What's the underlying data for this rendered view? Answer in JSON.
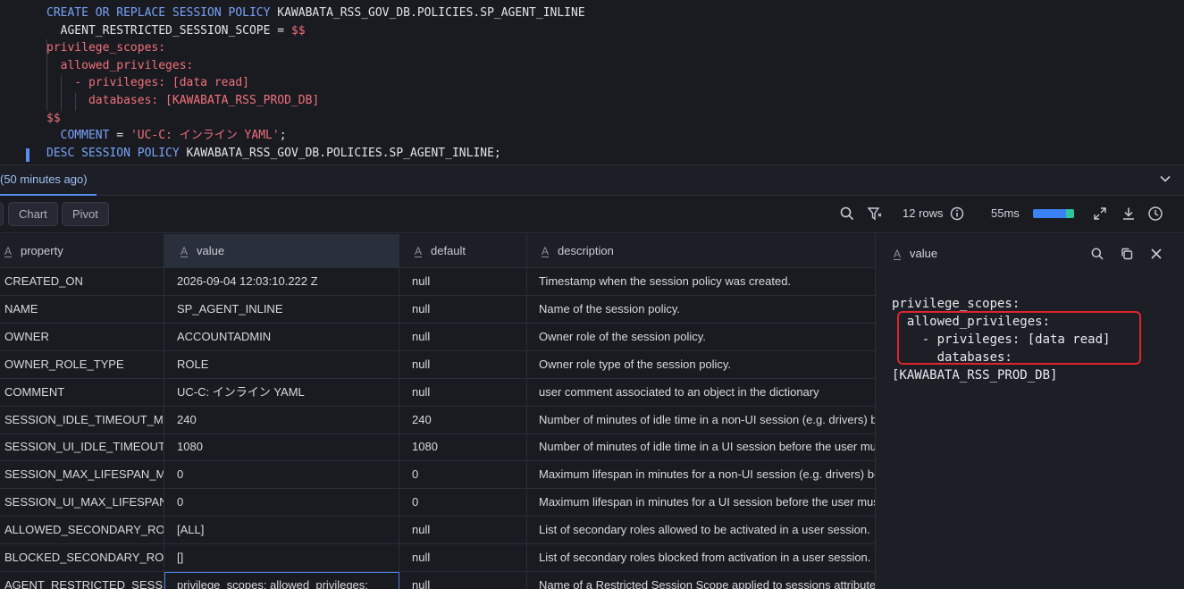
{
  "editor": {
    "ghost_line": "                        ",
    "lines": [
      {
        "parts": [
          {
            "t": "CREATE OR REPLACE SESSION POLICY ",
            "c": "kw"
          },
          {
            "t": "KAWABATA_RSS_GOV_DB.POLICIES.SP_AGENT_INLINE",
            "c": "id"
          }
        ]
      },
      {
        "parts": [
          {
            "t": "  AGENT_RESTRICTED_SESSION_SCOPE = ",
            "c": "id"
          },
          {
            "t": "$$",
            "c": "red"
          }
        ]
      },
      {
        "parts": [
          {
            "t": "privilege_scopes:",
            "c": "red"
          }
        ]
      },
      {
        "parts": [
          {
            "t": "  allowed_privileges:",
            "c": "red"
          }
        ]
      },
      {
        "parts": [
          {
            "t": "    - privileges: [data read]",
            "c": "red"
          }
        ]
      },
      {
        "parts": [
          {
            "t": "      databases: [KAWABATA_RSS_PROD_DB]",
            "c": "red"
          }
        ]
      },
      {
        "parts": [
          {
            "t": "$$",
            "c": "red"
          }
        ]
      },
      {
        "parts": [
          {
            "t": "  COMMENT",
            "c": "kw"
          },
          {
            "t": " = ",
            "c": "id"
          },
          {
            "t": "'UC-C: インライン YAML'",
            "c": "str"
          },
          {
            "t": ";",
            "c": "id"
          }
        ]
      },
      {
        "parts": [
          {
            "t": "DESC SESSION POLICY ",
            "c": "kw"
          },
          {
            "t": "KAWABATA_RSS_GOV_DB.POLICIES.SP_AGENT_INLINE",
            "c": "id"
          },
          {
            "t": ";",
            "c": "id"
          }
        ]
      }
    ]
  },
  "results_header": {
    "query_tab_label": "(50 minutes ago)",
    "collapse_icon": "chevron-down-icon"
  },
  "toolbar": {
    "chart_label": "Chart",
    "pivot_label": "Pivot",
    "row_count": "12 rows",
    "duration": "55ms",
    "duration_bar_fraction": 1.0
  },
  "grid": {
    "columns": [
      "property",
      "value",
      "default",
      "description"
    ],
    "rows": [
      [
        "CREATED_ON",
        "2026-09-04 12:03:10.222 Z",
        "null",
        "Timestamp when the session policy was created."
      ],
      [
        "NAME",
        "SP_AGENT_INLINE",
        "null",
        "Name of the session policy."
      ],
      [
        "OWNER",
        "ACCOUNTADMIN",
        "null",
        "Owner role of the session policy."
      ],
      [
        "OWNER_ROLE_TYPE",
        "ROLE",
        "null",
        "Owner role type of the session policy."
      ],
      [
        "COMMENT",
        "UC-C: インライン YAML",
        "null",
        "user comment associated to an object in the dictionary"
      ],
      [
        "SESSION_IDLE_TIMEOUT_MINS",
        "240",
        "240",
        "Number of minutes of idle time in a non-UI session (e.g. drivers) before the user must re-authenticate."
      ],
      [
        "SESSION_UI_IDLE_TIMEOUT_MINS",
        "1080",
        "1080",
        "Number of minutes of idle time in a UI session before the user must re-authenticate."
      ],
      [
        "SESSION_MAX_LIFESPAN_MINS",
        "0",
        "0",
        "Maximum lifespan in minutes for a non-UI session (e.g. drivers) before the user must re-authenticate."
      ],
      [
        "SESSION_UI_MAX_LIFESPAN_MINS",
        "0",
        "0",
        "Maximum lifespan in minutes for a UI session before the user must re-authenticate."
      ],
      [
        "ALLOWED_SECONDARY_ROLES",
        "[ALL]",
        "null",
        "List of secondary roles allowed to be activated in a user session."
      ],
      [
        "BLOCKED_SECONDARY_ROLES",
        "[]",
        "null",
        "List of secondary roles blocked from activation in a user session."
      ],
      [
        "AGENT_RESTRICTED_SESSION_SCOPE",
        " privilege_scopes:   allowed_privileges:",
        "null",
        "Name of a Restricted Session Scope applied to sessions attributed to agents."
      ]
    ]
  },
  "side_panel": {
    "title": "value",
    "code": "privilege_scopes:\n  allowed_privileges:\n    - privileges: [data read]\n      databases:\n[KAWABATA_RSS_PROD_DB]"
  }
}
